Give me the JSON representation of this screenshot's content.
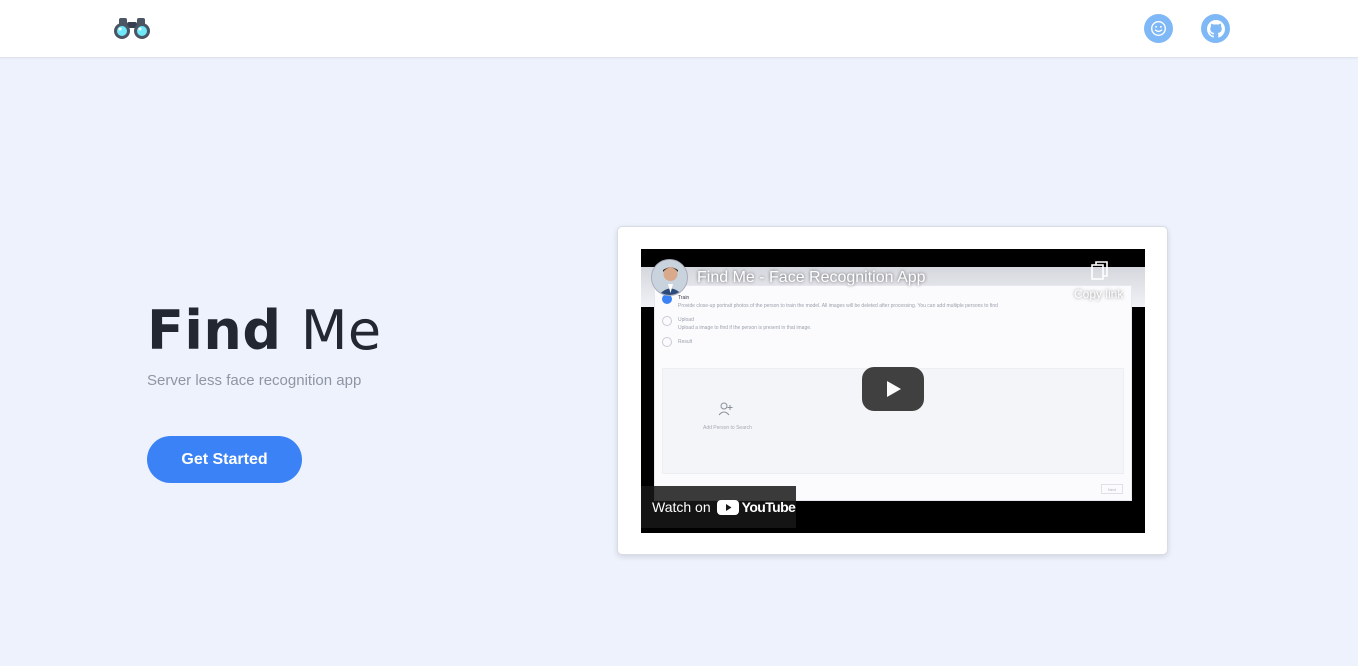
{
  "brand": {
    "logo_icon": "binoculars-icon"
  },
  "nav": {
    "icons": [
      "smile-icon",
      "github-icon"
    ],
    "icon_color": "#7fb8f6"
  },
  "hero": {
    "title_bold": "Find",
    "title_light": "Me",
    "subtitle": "Server less face recognition app",
    "cta_label": "Get Started",
    "cta_color": "#3b82f6"
  },
  "video": {
    "title": "Find Me - Face Recognition App",
    "copy_link_label": "Copy link",
    "watch_on_label": "Watch on",
    "youtube_label": "YouTube",
    "thumbnail": {
      "steps": [
        {
          "title": "Train",
          "desc": "Provide close-up portrait photos of the person to train the model. All images will be deleted after processing. You can add multiple persons to find"
        },
        {
          "title": "Upload",
          "desc": "Upload a image to find if the person is present in that image."
        },
        {
          "title": "Result",
          "desc": ""
        }
      ],
      "dropzone_label": "Add Person to Search",
      "next_label": "Next"
    }
  }
}
